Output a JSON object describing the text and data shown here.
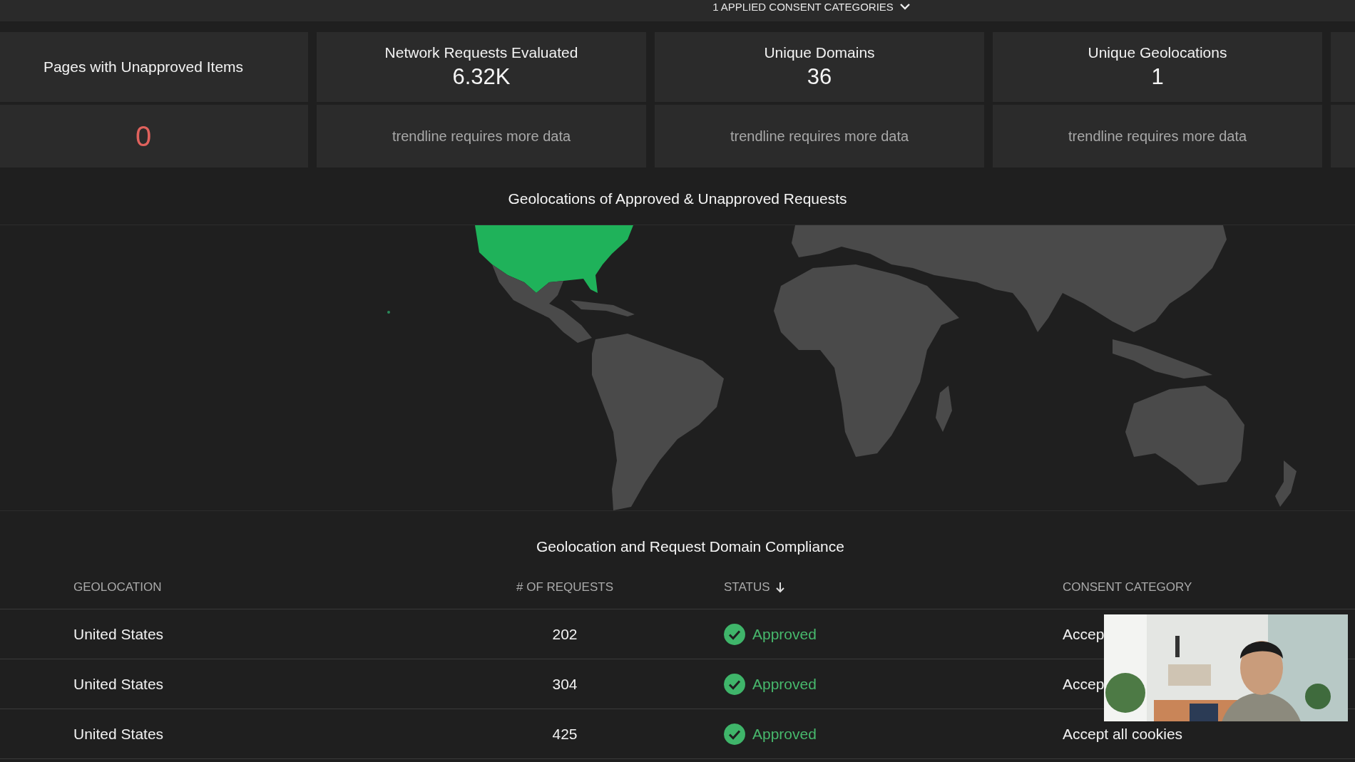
{
  "top_bar": {
    "filter_label": "1 APPLIED CONSENT CATEGORIES"
  },
  "cards": [
    {
      "kind": "count",
      "title": "Pages with Unapproved Items",
      "value": "0",
      "alert": true
    },
    {
      "kind": "metric",
      "title": "Network Requests Evaluated",
      "value": "6.32K",
      "trend": "trendline requires more data"
    },
    {
      "kind": "metric",
      "title": "Unique Domains",
      "value": "36",
      "trend": "trendline requires more data"
    },
    {
      "kind": "metric",
      "title": "Unique Geolocations",
      "value": "1",
      "trend": "trendline requires more data"
    }
  ],
  "map": {
    "title": "Geolocations of Approved & Unapproved Requests"
  },
  "table": {
    "title": "Geolocation and Request Domain Compliance",
    "columns": [
      {
        "label": "GEOLOCATION",
        "sorted": false
      },
      {
        "label": "# OF REQUESTS",
        "sorted": false
      },
      {
        "label": "STATUS",
        "sorted": true
      },
      {
        "label": "CONSENT CATEGORY",
        "sorted": false
      }
    ],
    "rows": [
      {
        "geolocation": "United States",
        "requests": "202",
        "status": {
          "kind": "approved",
          "label": "Approved"
        },
        "consent_category": "Accep"
      },
      {
        "geolocation": "United States",
        "requests": "304",
        "status": {
          "kind": "approved",
          "label": "Approved"
        },
        "consent_category": "Accep"
      },
      {
        "geolocation": "United States",
        "requests": "425",
        "status": {
          "kind": "approved",
          "label": "Approved"
        },
        "consent_category": "Accept all cookies"
      }
    ]
  }
}
